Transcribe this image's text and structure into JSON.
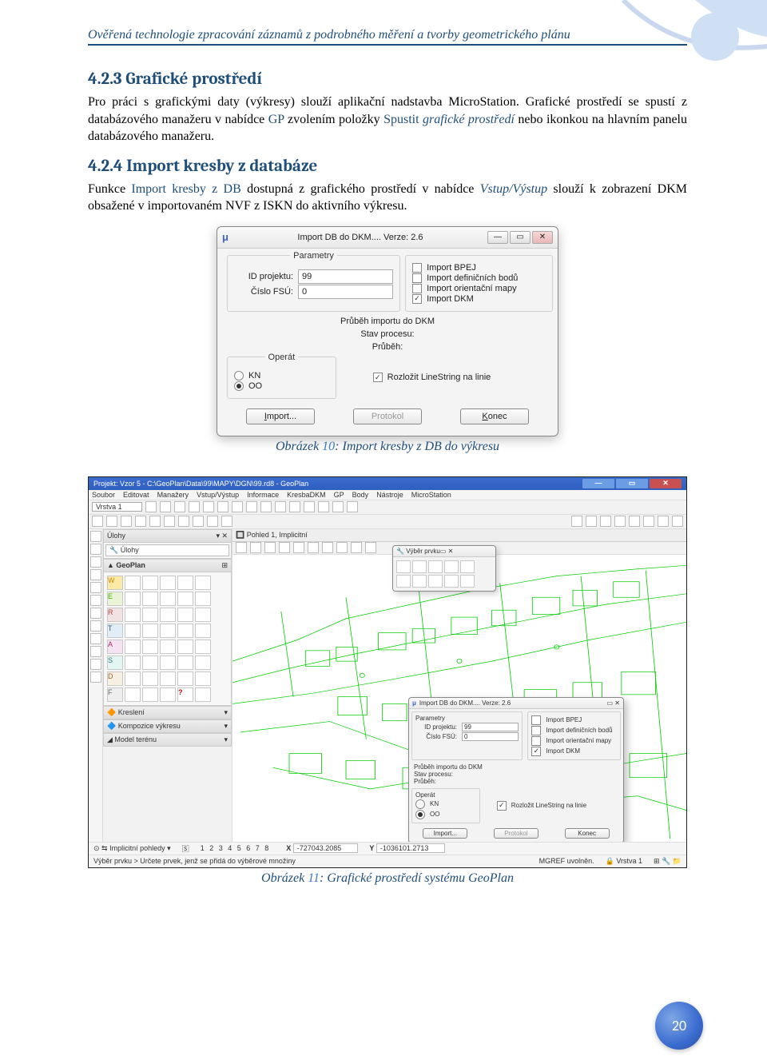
{
  "runningHead": "Ověřená technologie zpracování záznamů z podrobného měření a tvorby geometrického plánu",
  "sec1": {
    "heading": "4.2.3   Grafické prostředí",
    "p_lead": "Pro  práci  s grafickými  daty  (výkresy)  slouží  aplikační  nadstavba  MicroStation.  Grafické prostředí se spustí z databázového manažeru v nabídce ",
    "kw_gp": "GP",
    "p_mid": " zvolením položky ",
    "kw_spustit": "Spustit",
    "kw_graf_prostredi": " grafické prostředí",
    "p_tail": " nebo ikonkou na hlavním panelu databázového manažeru."
  },
  "sec2": {
    "heading": "4.2.4   Import kresby z databáze",
    "p_lead": "Funkce ",
    "kw_import": "Import kresby z DB",
    "p_mid": " dostupná z grafického prostředí v nabídce ",
    "kw_vstup": "Vstup/Výstup",
    "p_tail": " slouží k zobrazení DKM obsažené v importovaném NVF z ISKN do aktivního výkresu."
  },
  "dialog": {
    "title": "Import DB do DKM.... Verze: 2.6",
    "group_params": "Parametry",
    "lbl_id": "ID projektu:",
    "val_id": "99",
    "lbl_fsu": "Číslo FSÚ:",
    "val_fsu": "0",
    "chk_bpej": "Import BPEJ",
    "chk_defbody": "Import definičních bodů",
    "chk_orient": "Import orientační mapy",
    "chk_dkm": "Import DKM",
    "lbl_prubeh_hdr": "Průběh importu do DKM",
    "lbl_stav": "Stav procesu:",
    "lbl_prubeh": "Průběh:",
    "group_operat": "Operát",
    "radio_kn": "KN",
    "radio_oo": "OO",
    "chk_rozlozit": "Rozložit LineString na linie",
    "btn_import": "Import...",
    "btn_protokol": "Protokol",
    "btn_konec": "Konec"
  },
  "caption1_lead": "Obrázek ",
  "caption1_num": "10",
  "caption1_tail": ": Import kresby z DB do výkresu",
  "ms": {
    "title": "Projekt: Vzor 5 - C:\\GeoPlan\\Data\\99\\MAPY\\DGN\\99.rd8 - GeoPlan",
    "menu": [
      "Soubor",
      "Editovat",
      "Manažery",
      "Vstup/Výstup",
      "Informace",
      "KresbaDKM",
      "GP",
      "Body",
      "Nástroje",
      "MicroStation"
    ],
    "layer_label": "Vrstva 1",
    "panel_ulohy": "Úlohy",
    "panel_ulohy2": "Úlohy",
    "panel_geoplan": "GeoPlan",
    "panel_kresleni": "Kreslení",
    "panel_komp": "Kompozice výkresu",
    "panel_model": "Model terénu",
    "view_title": "Pohled 1, Implicitní",
    "select_title": "Výběr prvku",
    "mini_title": "Import DB do DKM.... Verze: 2.6",
    "mini_params": "Parametry",
    "mini_id_lbl": "ID projektu:",
    "mini_id_val": "99",
    "mini_fsu_lbl": "Číslo FSÚ:",
    "mini_fsu_val": "0",
    "mini_prubeh": "Průběh importu do DKM",
    "mini_stav": "Stav procesu:",
    "mini_prub": "Průběh:",
    "mini_operat": "Operát",
    "mini_kn": "KN",
    "mini_oo": "OO",
    "mini_bpej": "Import BPEJ",
    "mini_def": "Import definičních bodů",
    "mini_orient": "Import orientační mapy",
    "mini_dkm": "Import DKM",
    "mini_rozl": "Rozložit LineString na linie",
    "mini_import": "Import...",
    "mini_protokol": "Protokol",
    "mini_konec": "Konec",
    "status_views": "1 2 3 4 5 6 7 8",
    "status_x_lbl": "X",
    "status_x": "-727043.2085",
    "status_y_lbl": "Y",
    "status_y": "-1036101.2713",
    "status_msg": "Výběr prvku > Určete prvek, jenž se přidá do výběrové množiny",
    "status_mid": "MGREF uvolněn.",
    "status_layer": "Vrstva 1",
    "tabs_label": "Implicitní pohledy"
  },
  "caption2_lead": "Obrázek ",
  "caption2_num": "11",
  "caption2_tail": ": Grafické prostředí systému GeoPlan",
  "pageNum": "20"
}
